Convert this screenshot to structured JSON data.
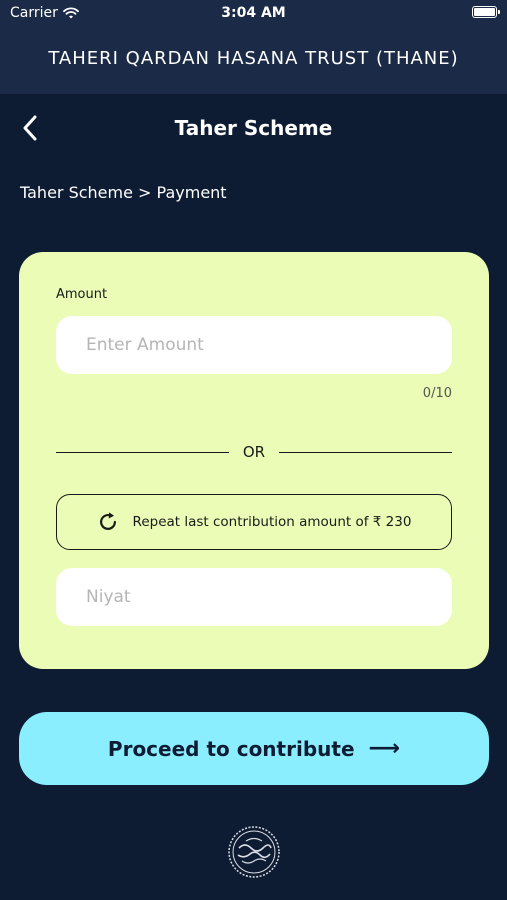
{
  "status_bar": {
    "carrier": "Carrier",
    "time": "3:04 AM"
  },
  "header": {
    "app_title": "TAHERI QARDAN HASANA TRUST (THANE)"
  },
  "nav": {
    "title": "Taher Scheme"
  },
  "breadcrumb": "Taher Scheme > Payment",
  "form": {
    "amount_label": "Amount",
    "amount_placeholder": "Enter Amount",
    "amount_value": "",
    "char_count": "0/10",
    "or_text": "OR",
    "repeat_label": "Repeat last contribution amount of ₹ 230",
    "niyat_placeholder": "Niyat",
    "niyat_value": ""
  },
  "proceed_label": "Proceed to contribute",
  "colors": {
    "background": "#0e1c33",
    "header": "#1b2b47",
    "card": "#ebfcb6",
    "accent": "#8beeff"
  }
}
